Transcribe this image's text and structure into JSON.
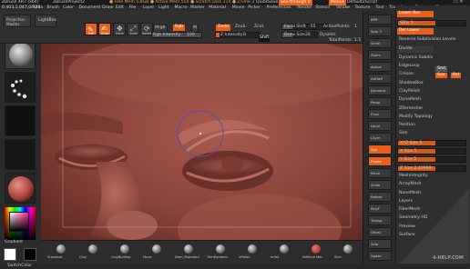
{
  "titlebar": {
    "app": "ZBrush 4R7 (x64)",
    "project": "ZBrushProject2",
    "info": "● Free Mem 5.8GB ● Active Mem 554 ● Scratch Disk 114 ● ZTime 3",
    "quicksave": "QuickSave",
    "seethrough": "See-through 0",
    "menus": "Menus",
    "script": "DefaultZScript"
  },
  "menubar": {
    "coords": "0.403,1.047,0.724",
    "items": [
      "Alpha",
      "Brush",
      "Color",
      "Document",
      "Draw",
      "Edit",
      "File",
      "Layer",
      "Light",
      "Macro",
      "Marker",
      "Material",
      "Movie",
      "Picker",
      "Preferences",
      "Render",
      "Stencil",
      "Stroke",
      "Texture",
      "Tool",
      "Transform",
      "Zplugin",
      "Zscript"
    ]
  },
  "topshelf": {
    "projection_master": "Projection Master",
    "lightbox": "LightBox",
    "edit": "Edit",
    "draw": "Draw",
    "move": "Move",
    "scale": "Scale",
    "rotate": "Rotate",
    "mrgb": "Mrgb",
    "rgb": "Rgb",
    "m": "M",
    "rgb_intensity_label": "Rgb Intensity",
    "rgb_intensity": "100",
    "zadd": "Zadd",
    "zsub": "Zsub",
    "zcut": "Zcut",
    "z_intensity_label": "Z Intensity",
    "z_intensity": "8",
    "shift_badge": "Shift",
    "focal_shift_label": "Focal Shift",
    "focal_shift": "-55",
    "draw_size_label": "Draw Size",
    "draw_size": "28",
    "dynamic": "Dynamic",
    "active_points_label": "ActivePoints:",
    "active_points": "1",
    "total_points_label": "TotalPoints:",
    "total_points": "1.5"
  },
  "leftshelf": {
    "gradient_label": "Gradient",
    "switchcolor_label": "SwitchColor"
  },
  "bottomshelf": {
    "brushes": [
      "Standard",
      "Clay",
      "ClayBuildup",
      "Move",
      "Dam_Standard",
      "TrimDynamic",
      "hPolish",
      "Inflat",
      "MAHcut Mec",
      "Slim"
    ]
  },
  "rightshelf": {
    "items": [
      "BPR",
      "Spix 3",
      "Scroll",
      "Zoom",
      "Actual",
      "AAHalf",
      "Dynamic",
      "Persp",
      "Floor",
      "Local",
      "LSym",
      "Xyz",
      "Frame",
      "Move",
      "Scale",
      "Rotate",
      "PolyF",
      "Transp",
      "Ghost",
      "Solo",
      "Xpose"
    ]
  },
  "rightpanel": {
    "items": [
      {
        "label": "Lower Res",
        "style": "orange"
      },
      {
        "label": "SDiv 5",
        "style": "slider"
      },
      {
        "label": "Del Lower",
        "style": "orange"
      },
      {
        "label": "Reverse Subdivision Levels",
        "style": "plain"
      },
      {
        "label": "Divide",
        "style": "section"
      },
      {
        "label": "Dynamic Subdiv",
        "style": "plain"
      },
      {
        "label": "EdgeLoop",
        "style": "plain"
      },
      {
        "label": "Crease",
        "style": "plain"
      },
      {
        "label": "ShadowBox",
        "style": "plain"
      },
      {
        "label": "ClayPolish",
        "style": "plain"
      },
      {
        "label": "DynaMesh",
        "style": "plain"
      },
      {
        "label": "ZRemesher",
        "style": "plain"
      },
      {
        "label": "Modify Topology",
        "style": "plain"
      },
      {
        "label": "Position",
        "style": "plain"
      },
      {
        "label": "Size",
        "style": "plain"
      },
      {
        "label": "XYZ Size 5",
        "style": "slider"
      },
      {
        "label": "X Size 5",
        "style": "slider"
      },
      {
        "label": "Y Size 5",
        "style": "slider"
      },
      {
        "label": "Z Size 2.40999",
        "style": "slider"
      },
      {
        "label": "MeshIntegrity",
        "style": "plain"
      },
      {
        "label": "ArrayMesh",
        "style": "plain"
      },
      {
        "label": "NanoMesh",
        "style": "plain"
      },
      {
        "label": "Layers",
        "style": "plain"
      },
      {
        "label": "FiberMesh",
        "style": "plain"
      },
      {
        "label": "Geometry HD",
        "style": "plain"
      },
      {
        "label": "Preview",
        "style": "plain"
      },
      {
        "label": "Surface",
        "style": "plain"
      }
    ],
    "smt": "Smt",
    "suv": "Suv",
    "rel": "Rel",
    "watermark": "4-HELP.COM"
  },
  "colors": {
    "accent": "#e8601a",
    "skin": "#8a4a40"
  }
}
